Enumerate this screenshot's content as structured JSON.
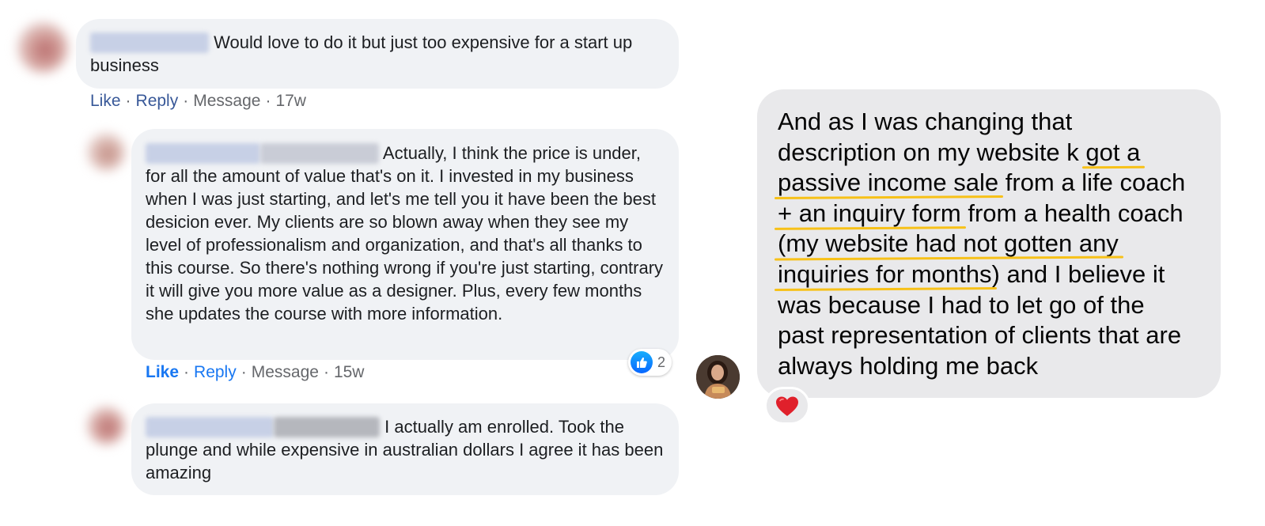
{
  "comments": [
    {
      "body": "Would love to do it but just too expensive for a start up business",
      "actions": {
        "like": "Like",
        "reply": "Reply",
        "message": "Message",
        "time": "17w"
      }
    },
    {
      "body": "Actually, I think the price is under, for all the amount of value that's on it. I invested in my business when I was just starting, and let's me tell you it have been the best desicion ever. My clients are so blown away when they see my level of professionalism and organization, and that's all thanks to this course. So there's nothing wrong if you're just starting, contrary it will give you more value as a designer. Plus, every few months she updates the course with more information.",
      "actions": {
        "like": "Like",
        "reply": "Reply",
        "message": "Message",
        "time": "15w"
      },
      "reaction": {
        "icon": "thumbs-up-icon",
        "count": "2"
      }
    },
    {
      "body": "I actually am enrolled. Took the plunge and while expensive in australian dollars I agree it has been amazing"
    }
  ],
  "message": {
    "lines": [
      [
        "And as I was changing that"
      ],
      [
        "description on my website k ",
        "got a"
      ],
      [
        "passive income sale",
        " from a life coach"
      ],
      [
        "+ an inquiry form",
        " from a health coach"
      ],
      [
        "(my website had not gotten any"
      ],
      [
        "inquiries for months",
        ") and I believe it"
      ],
      [
        "was because I had to let go of the"
      ],
      [
        "past representation of clients that are"
      ],
      [
        "always holding me back"
      ]
    ],
    "reaction": {
      "icon": "heart-icon",
      "emoji": "❤️"
    }
  },
  "colors": {
    "bubble": "#f0f2f5",
    "message_bubble": "#e9e9eb",
    "link": "#385898",
    "link_strong": "#1877f2",
    "highlight": "#f7c118"
  }
}
